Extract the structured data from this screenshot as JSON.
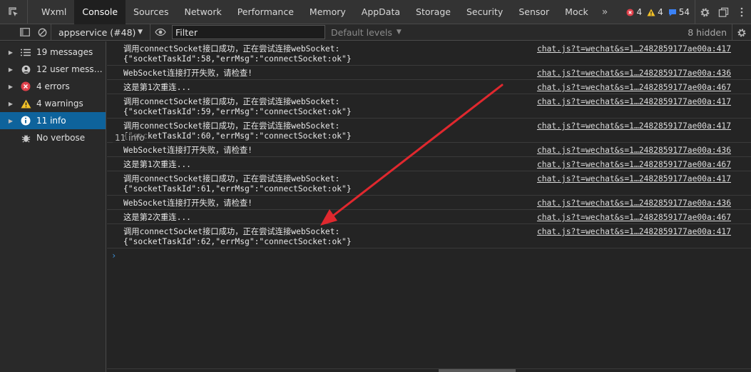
{
  "tabs": [
    "Wxml",
    "Console",
    "Sources",
    "Network",
    "Performance",
    "Memory",
    "AppData",
    "Storage",
    "Security",
    "Sensor",
    "Mock"
  ],
  "active_tab": "Console",
  "more_tabs": "»",
  "counts": {
    "errors": "4",
    "warnings": "4",
    "messages": "54"
  },
  "toolbar": {
    "context": "appservice (#48)",
    "filter_placeholder": "Filter",
    "levels": "Default levels",
    "hidden": "8 hidden"
  },
  "sidebar": {
    "items": [
      {
        "label": "19 messages",
        "icon": "list-icon"
      },
      {
        "label": "12 user mess…",
        "icon": "user-icon"
      },
      {
        "label": "4 errors",
        "icon": "error-icon"
      },
      {
        "label": "4 warnings",
        "icon": "warning-icon"
      },
      {
        "label": "11 info",
        "icon": "info-icon"
      },
      {
        "label": "No verbose",
        "icon": "bug-icon"
      }
    ],
    "tooltip": "11 info"
  },
  "logs": [
    {
      "lines": [
        "调用connectSocket接口成功，正在尝试连接webSocket:",
        "{\"socketTaskId\":58,\"errMsg\":\"connectSocket:ok\"}"
      ],
      "source": "chat.js?t=wechat&s=1…2482859177ae00a:417"
    },
    {
      "lines": [
        "WebSocket连接打开失败，请检查!"
      ],
      "source": "chat.js?t=wechat&s=1…2482859177ae00a:436"
    },
    {
      "lines": [
        "这是第1次重连..."
      ],
      "source": "chat.js?t=wechat&s=1…2482859177ae00a:467"
    },
    {
      "lines": [
        "调用connectSocket接口成功，正在尝试连接webSocket:",
        "{\"socketTaskId\":59,\"errMsg\":\"connectSocket:ok\"}"
      ],
      "source": "chat.js?t=wechat&s=1…2482859177ae00a:417"
    },
    {
      "lines": [
        "调用connectSocket接口成功，正在尝试连接webSocket:",
        "{\"socketTaskId\":60,\"errMsg\":\"connectSocket:ok\"}"
      ],
      "source": "chat.js?t=wechat&s=1…2482859177ae00a:417"
    },
    {
      "lines": [
        "WebSocket连接打开失败，请检查!"
      ],
      "source": "chat.js?t=wechat&s=1…2482859177ae00a:436"
    },
    {
      "lines": [
        "这是第1次重连..."
      ],
      "source": "chat.js?t=wechat&s=1…2482859177ae00a:467"
    },
    {
      "lines": [
        "调用connectSocket接口成功，正在尝试连接webSocket:",
        "{\"socketTaskId\":61,\"errMsg\":\"connectSocket:ok\"}"
      ],
      "source": "chat.js?t=wechat&s=1…2482859177ae00a:417"
    },
    {
      "lines": [
        "WebSocket连接打开失败，请检查!"
      ],
      "source": "chat.js?t=wechat&s=1…2482859177ae00a:436"
    },
    {
      "lines": [
        "这是第2次重连..."
      ],
      "source": "chat.js?t=wechat&s=1…2482859177ae00a:467"
    },
    {
      "lines": [
        "调用connectSocket接口成功，正在尝试连接webSocket:",
        "{\"socketTaskId\":62,\"errMsg\":\"connectSocket:ok\"}"
      ],
      "source": "chat.js?t=wechat&s=1…2482859177ae00a:417"
    }
  ],
  "prompt": "›",
  "colors": {
    "accent": "#0e639c",
    "error": "#e0404a",
    "warning": "#f2c128",
    "info_badge": "#3b82f6",
    "arrow": "#e0282e"
  }
}
